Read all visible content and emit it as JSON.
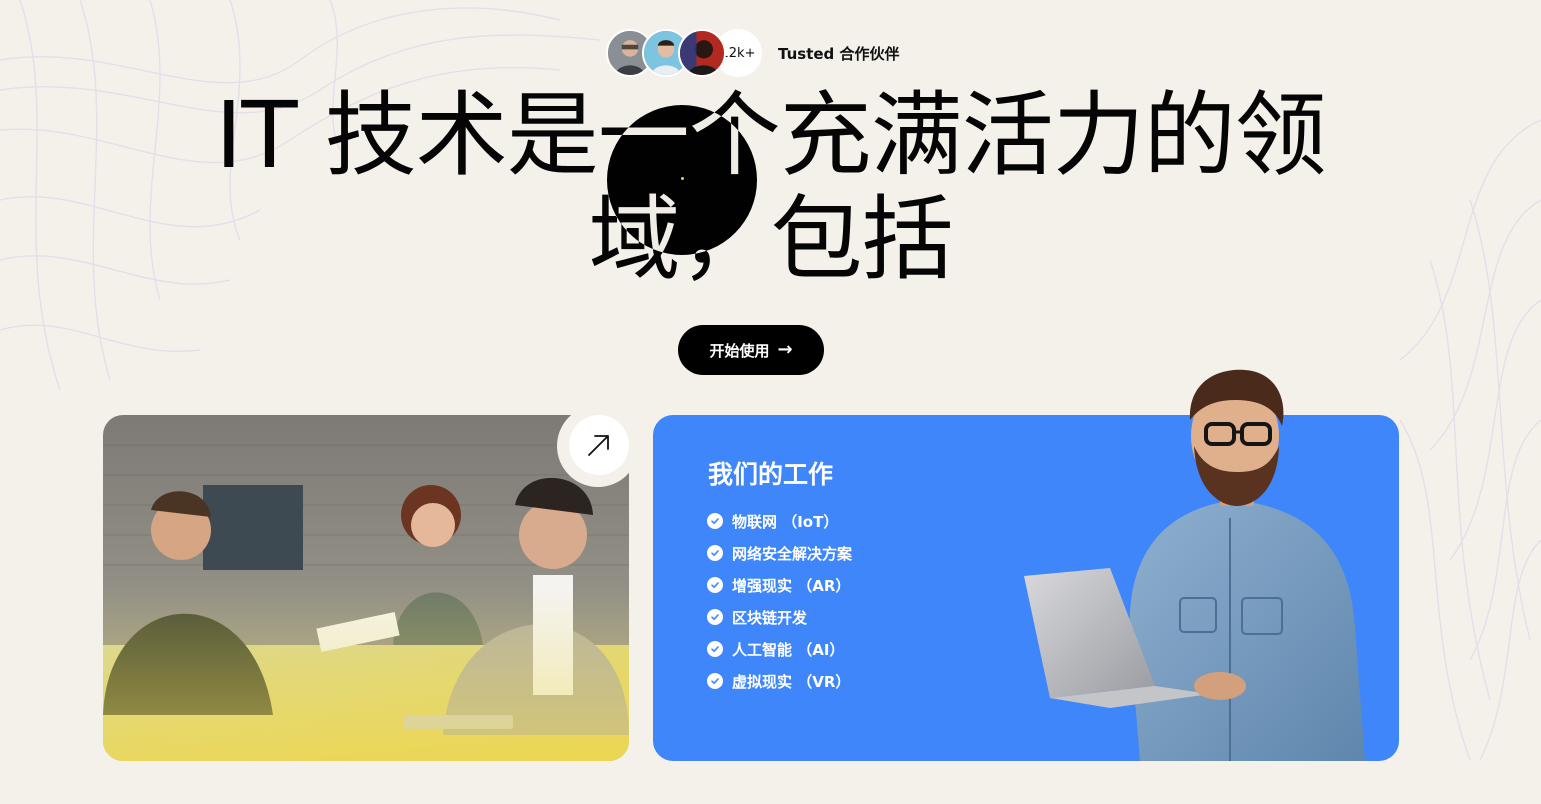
{
  "trusted": {
    "count": "12k+",
    "label": "Tusted 合作伙伴"
  },
  "hero": {
    "title_line1": "IT 技术是一个充满活力的领",
    "title_line2": "域，包括"
  },
  "cta": {
    "label": "开始使用",
    "icon": "arrow-right-icon"
  },
  "photo_card": {
    "icon": "arrow-up-right-icon"
  },
  "work": {
    "title": "我们的工作",
    "items": [
      "物联网 （IoT）",
      "网络安全解决方案",
      "增强现实 （AR）",
      "区块链开发",
      "人工智能 （AI）",
      "虚拟现实 （VR）"
    ]
  },
  "colors": {
    "background": "#f4f0ea",
    "accent_blue": "#3f86fb",
    "button_black": "#000000"
  }
}
